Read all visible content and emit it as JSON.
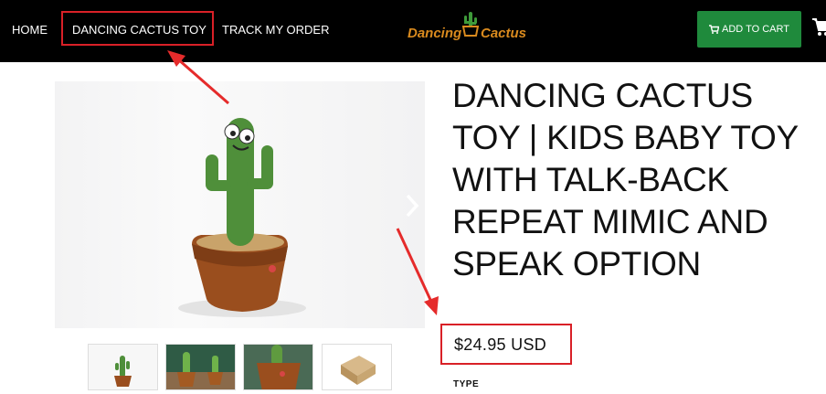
{
  "nav": {
    "home": "HOME",
    "product": "DANCING CACTUS TOY",
    "track": "TRACK MY ORDER"
  },
  "logo": {
    "word1": "Dancing",
    "word2": "Cactus"
  },
  "cart_button": "ADD TO CART",
  "product": {
    "title": "DANCING CACTUS TOY | KIDS BABY TOY WITH TALK-BACK REPEAT MIMIC AND SPEAK OPTION",
    "price": "$24.95 USD",
    "type_label": "TYPE"
  },
  "colors": {
    "header_bg": "#000000",
    "cart_button": "#1f8a3c",
    "logo": "#d98a1e",
    "annotation": "#d92027"
  }
}
